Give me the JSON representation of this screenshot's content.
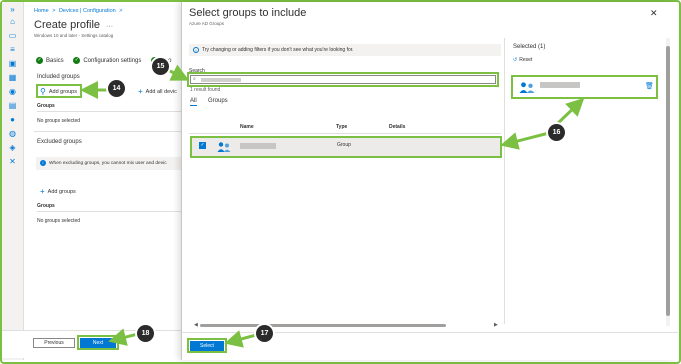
{
  "breadcrumb": [
    "Home",
    ">",
    "Devices | Configuration",
    ">"
  ],
  "page": {
    "title": "Create profile",
    "more": "···",
    "subtitle": "Windows 10 and later - Settings catalog"
  },
  "steps": [
    {
      "label": "Basics"
    },
    {
      "label": "Configuration settings"
    },
    {
      "label": "Sco"
    }
  ],
  "included": {
    "label": "Included groups",
    "add_groups": "Add groups",
    "add_all": "Add all devic",
    "table_header": "Groups",
    "empty": "No groups selected"
  },
  "excluded": {
    "label": "Excluded groups",
    "info": "When excluding groups, you cannot mix user and devic",
    "add_groups": "Add groups",
    "table_header": "Groups",
    "empty": "No groups selected"
  },
  "footer_left": {
    "previous": "Previous",
    "next": "Next"
  },
  "panel": {
    "title": "Select groups to include",
    "subtitle": "Azure AD Groups",
    "filter_notice": "Try changing or adding filters if you don't see what you're looking for.",
    "search_label": "Search",
    "search_value": "",
    "result_count": "1 result found",
    "tabs": [
      "All",
      "Groups"
    ],
    "columns": [
      "Name",
      "Type",
      "Details"
    ],
    "rows": [
      {
        "type": "Group",
        "checked": true
      }
    ],
    "selected_title": "Selected (1)",
    "reset": "Reset",
    "select_button": "Select"
  },
  "callouts": [
    "14",
    "15",
    "16",
    "17",
    "18"
  ],
  "colors": {
    "accent": "#0078d4",
    "highlight": "#7cc043",
    "callout_bg": "#2b2b2b"
  },
  "icons": {
    "close": "close-icon",
    "info": "info-icon",
    "filter_info": "info-icon",
    "search": "search-icon",
    "add": "person-add-icon",
    "plus": "plus-icon",
    "check": "checkmark-icon",
    "group_avatar": "group-icon",
    "delete": "trash-icon",
    "reset": "reset-icon"
  }
}
